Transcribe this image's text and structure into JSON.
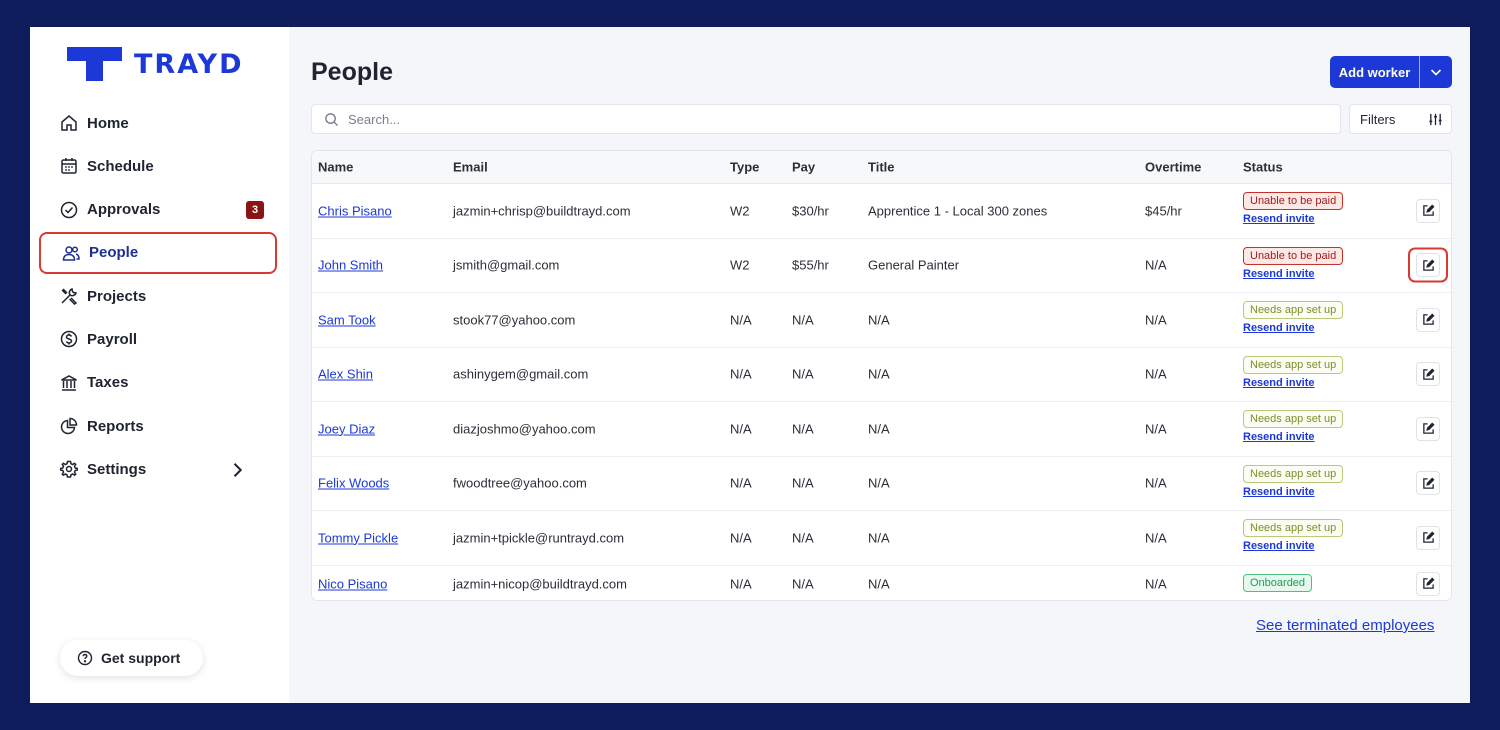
{
  "brand": {
    "name": "TRAYD",
    "color": "#1c38d6"
  },
  "sidebar": {
    "items": [
      {
        "label": "Home",
        "icon": "home-icon"
      },
      {
        "label": "Schedule",
        "icon": "calendar-icon"
      },
      {
        "label": "Approvals",
        "icon": "check-circle-icon",
        "badge": "3"
      },
      {
        "label": "People",
        "icon": "people-icon",
        "active": true
      },
      {
        "label": "Projects",
        "icon": "tools-icon"
      },
      {
        "label": "Payroll",
        "icon": "dollar-circle-icon"
      },
      {
        "label": "Taxes",
        "icon": "bank-icon"
      },
      {
        "label": "Reports",
        "icon": "pie-chart-icon"
      },
      {
        "label": "Settings",
        "icon": "gear-icon"
      }
    ],
    "support_label": "Get support"
  },
  "page": {
    "title": "People",
    "add_button_label": "Add worker",
    "search_placeholder": "Search...",
    "filters_label": "Filters",
    "terminated_link": "See terminated employees"
  },
  "table": {
    "headers": [
      "Name",
      "Email",
      "Type",
      "Pay",
      "Title",
      "Overtime",
      "Status"
    ],
    "rows": [
      {
        "name": "Chris Pisano",
        "email": "jazmin+chrisp@buildtrayd.com",
        "type": "W2",
        "pay": "$30/hr",
        "title": "Apprentice 1 - Local 300 zones",
        "overtime": "$45/hr",
        "status": "Unable to be paid",
        "status_kind": "red",
        "resend": "Resend invite"
      },
      {
        "name": "John Smith",
        "email": "jsmith@gmail.com",
        "type": "W2",
        "pay": "$55/hr",
        "title": "General Painter",
        "overtime": "N/A",
        "status": "Unable to be paid",
        "status_kind": "red",
        "resend": "Resend invite",
        "highlight": true
      },
      {
        "name": "Sam Took",
        "email": "stook77@yahoo.com",
        "type": "N/A",
        "pay": "N/A",
        "title": "N/A",
        "overtime": "N/A",
        "status": "Needs app set up",
        "status_kind": "olive",
        "resend": "Resend invite"
      },
      {
        "name": "Alex Shin",
        "email": "ashinygem@gmail.com",
        "type": "N/A",
        "pay": "N/A",
        "title": "N/A",
        "overtime": "N/A",
        "status": "Needs app set up",
        "status_kind": "olive",
        "resend": "Resend invite"
      },
      {
        "name": "Joey Diaz",
        "email": "diazjoshmo@yahoo.com",
        "type": "N/A",
        "pay": "N/A",
        "title": "N/A",
        "overtime": "N/A",
        "status": "Needs app set up",
        "status_kind": "olive",
        "resend": "Resend invite"
      },
      {
        "name": "Felix Woods",
        "email": "fwoodtree@yahoo.com",
        "type": "N/A",
        "pay": "N/A",
        "title": "N/A",
        "overtime": "N/A",
        "status": "Needs app set up",
        "status_kind": "olive",
        "resend": "Resend invite"
      },
      {
        "name": "Tommy Pickle",
        "email": "jazmin+tpickle@runtrayd.com",
        "type": "N/A",
        "pay": "N/A",
        "title": "N/A",
        "overtime": "N/A",
        "status": "Needs app set up",
        "status_kind": "olive",
        "resend": "Resend invite"
      },
      {
        "name": "Nico Pisano",
        "email": "jazmin+nicop@buildtrayd.com",
        "type": "N/A",
        "pay": "N/A",
        "title": "N/A",
        "overtime": "N/A",
        "status": "Onboarded",
        "status_kind": "green",
        "resend": null
      }
    ]
  }
}
